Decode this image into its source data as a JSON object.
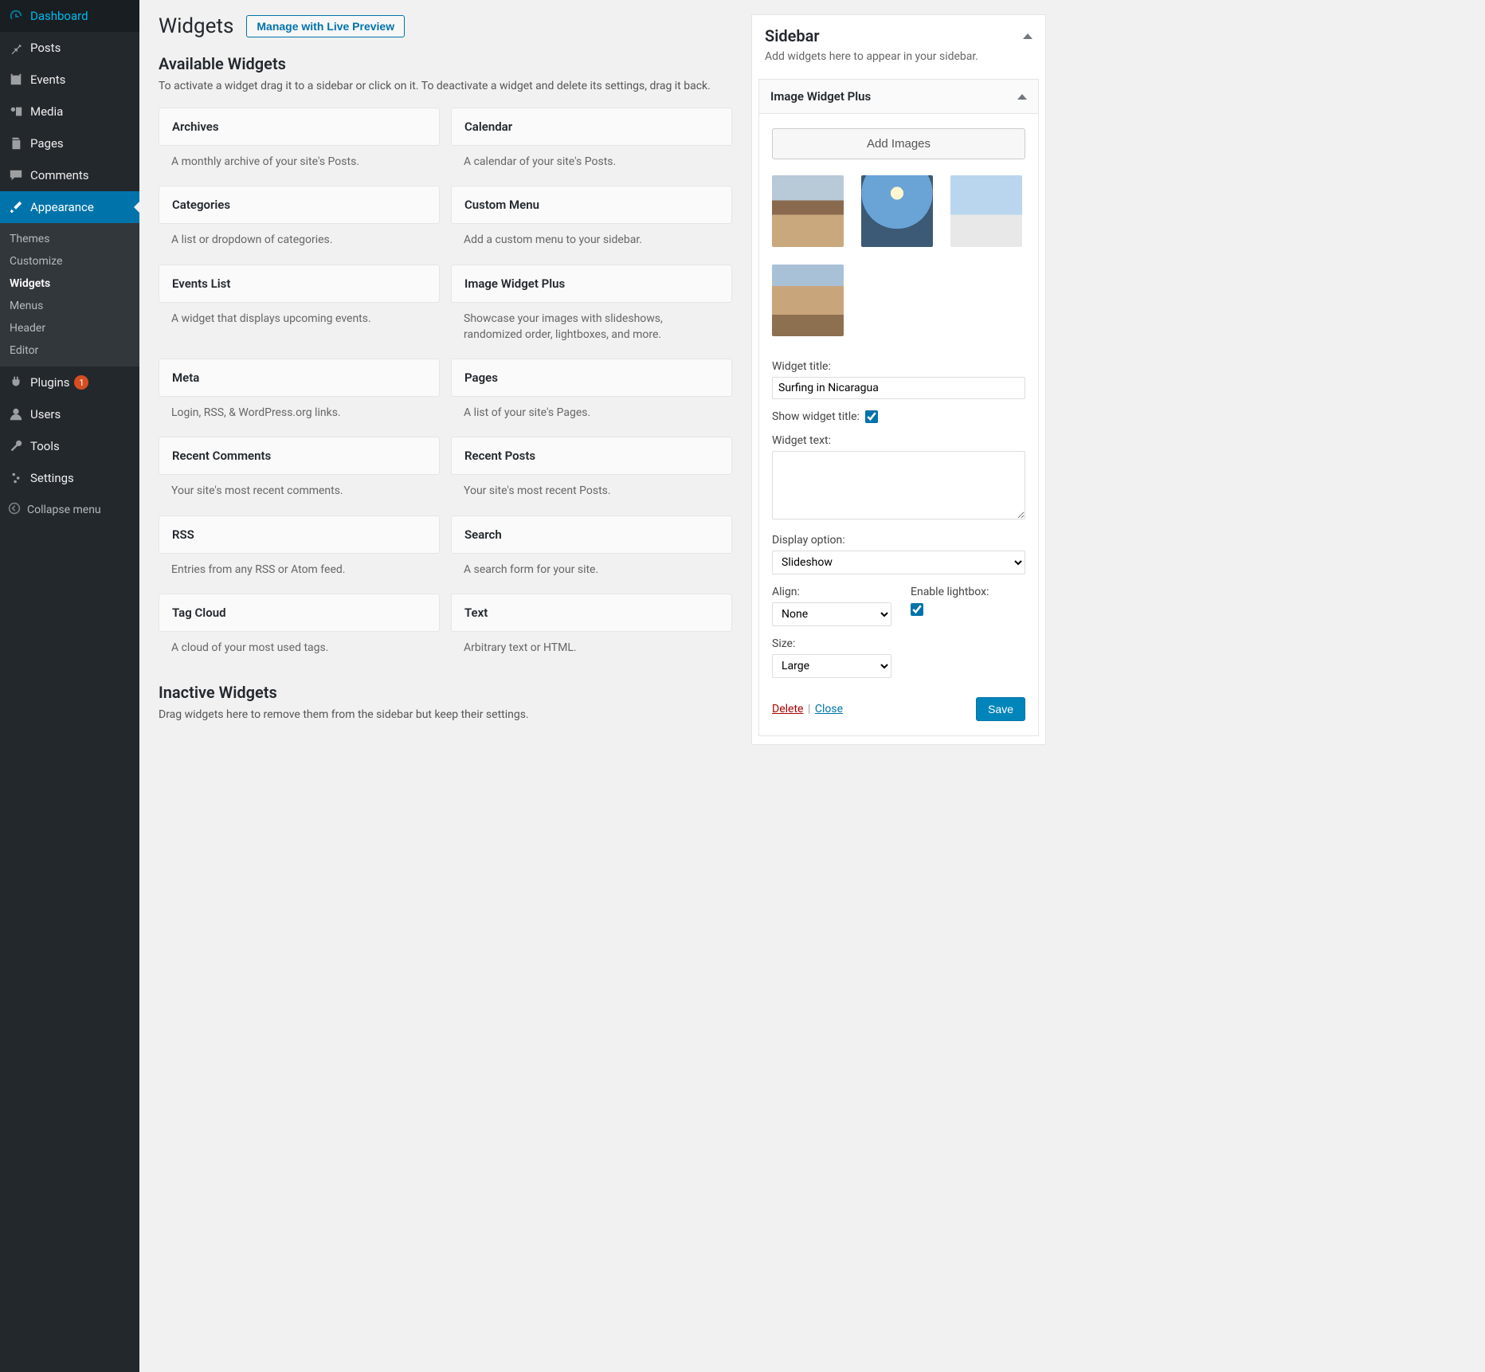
{
  "nav": {
    "dashboard": "Dashboard",
    "posts": "Posts",
    "events": "Events",
    "media": "Media",
    "pages": "Pages",
    "comments": "Comments",
    "appearance": "Appearance",
    "plugins": "Plugins",
    "plugins_badge": "1",
    "users": "Users",
    "tools": "Tools",
    "settings": "Settings",
    "collapse": "Collapse menu"
  },
  "appearance_sub": {
    "themes": "Themes",
    "customize": "Customize",
    "widgets": "Widgets",
    "menus": "Menus",
    "header": "Header",
    "editor": "Editor"
  },
  "page": {
    "title": "Widgets",
    "live_preview_btn": "Manage with Live Preview"
  },
  "available": {
    "heading": "Available Widgets",
    "desc": "To activate a widget drag it to a sidebar or click on it. To deactivate a widget and delete its settings, drag it back."
  },
  "widgets": [
    {
      "name": "Archives",
      "desc": "A monthly archive of your site's Posts."
    },
    {
      "name": "Calendar",
      "desc": "A calendar of your site's Posts."
    },
    {
      "name": "Categories",
      "desc": "A list or dropdown of categories."
    },
    {
      "name": "Custom Menu",
      "desc": "Add a custom menu to your sidebar."
    },
    {
      "name": "Events List",
      "desc": "A widget that displays upcoming events."
    },
    {
      "name": "Image Widget Plus",
      "desc": "Showcase your images with slideshows, randomized order, lightboxes, and more."
    },
    {
      "name": "Meta",
      "desc": "Login, RSS, & WordPress.org links."
    },
    {
      "name": "Pages",
      "desc": "A list of your site's Pages."
    },
    {
      "name": "Recent Comments",
      "desc": "Your site's most recent comments."
    },
    {
      "name": "Recent Posts",
      "desc": "Your site's most recent Posts."
    },
    {
      "name": "RSS",
      "desc": "Entries from any RSS or Atom feed."
    },
    {
      "name": "Search",
      "desc": "A search form for your site."
    },
    {
      "name": "Tag Cloud",
      "desc": "A cloud of your most used tags."
    },
    {
      "name": "Text",
      "desc": "Arbitrary text or HTML."
    }
  ],
  "inactive": {
    "heading": "Inactive Widgets",
    "desc": "Drag widgets here to remove them from the sidebar but keep their settings."
  },
  "sidebar_area": {
    "title": "Sidebar",
    "desc": "Add widgets here to appear in your sidebar."
  },
  "iwp": {
    "title": "Image Widget Plus",
    "add_images_btn": "Add Images",
    "widget_title_label": "Widget title:",
    "widget_title_value": "Surfing in Nicaragua",
    "show_widget_title_label": "Show widget title:",
    "show_widget_title_checked": true,
    "widget_text_label": "Widget text:",
    "widget_text_value": "",
    "display_option_label": "Display option:",
    "display_option_value": "Slideshow",
    "align_label": "Align:",
    "align_value": "None",
    "lightbox_label": "Enable lightbox:",
    "lightbox_checked": true,
    "size_label": "Size:",
    "size_value": "Large",
    "delete": "Delete",
    "close": "Close",
    "save": "Save"
  }
}
